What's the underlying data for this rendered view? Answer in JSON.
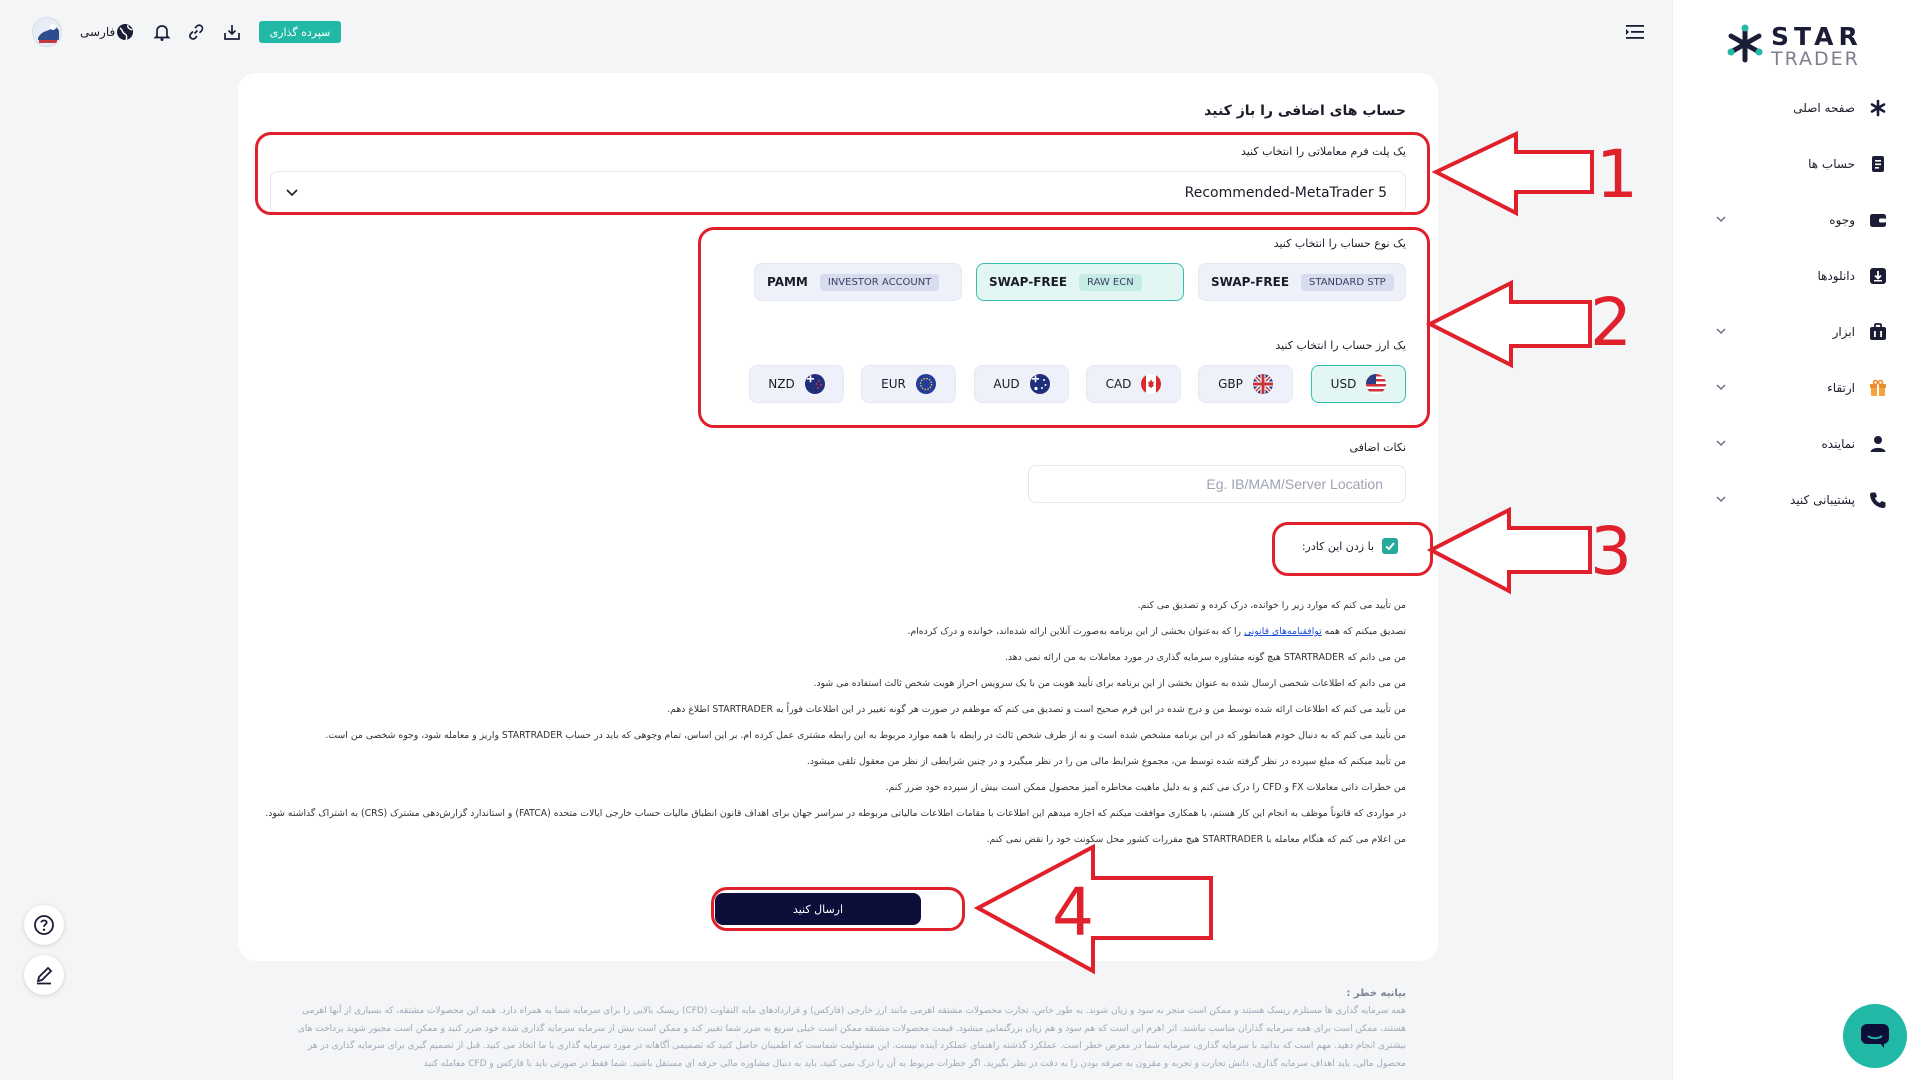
{
  "sidebar": {
    "logo_line1": "STAR",
    "logo_line2": "TRADER",
    "items": [
      {
        "label": "صفحه اصلی",
        "icon": "asterisk-icon"
      },
      {
        "label": "حساب ها",
        "icon": "accounts-icon"
      },
      {
        "label": "وجوه",
        "icon": "wallet-icon"
      },
      {
        "label": "دانلودها",
        "icon": "download-icon"
      },
      {
        "label": "ابزار",
        "icon": "toolbox-icon"
      },
      {
        "label": "ارتقاء",
        "icon": "gift-icon"
      },
      {
        "label": "نماینده",
        "icon": "user-icon"
      },
      {
        "label": "پشتیبانی کنید",
        "icon": "phone-icon"
      }
    ]
  },
  "topbar": {
    "deposit_label": "سپرده گذاری",
    "language_label": "فارسی"
  },
  "form": {
    "title": "حساب های اضافی را باز کنید",
    "platform_label": "یک پلت فرم معاملاتی را انتخاب کنید",
    "platform_value": "Recommended-MetaTrader 5",
    "account_type_label": "یک نوع حساب را انتخاب کنید",
    "account_types": [
      {
        "main": "SWAP-FREE",
        "sub": "STANDARD STP",
        "selected": false
      },
      {
        "main": "SWAP-FREE",
        "sub": "RAW ECN",
        "selected": true
      },
      {
        "main": "PAMM",
        "sub": "INVESTOR ACCOUNT",
        "selected": false
      }
    ],
    "currency_label": "یک ارز حساب را انتخاب کنید",
    "currencies": [
      {
        "code": "USD",
        "selected": true
      },
      {
        "code": "GBP",
        "selected": false
      },
      {
        "code": "CAD",
        "selected": false
      },
      {
        "code": "AUD",
        "selected": false
      },
      {
        "code": "EUR",
        "selected": false
      },
      {
        "code": "NZD",
        "selected": false
      }
    ],
    "notes_label": "نکات اضافی",
    "notes_placeholder": "Eg. IB/MAM/Server Location",
    "agree_label": "با زدن این کادر:",
    "agree_checked": true,
    "terms": [
      {
        "before": "من تأیید می کنم که موارد زیر را خوانده، درک کرده و تصدیق می کنم.",
        "link": "",
        "after": ""
      },
      {
        "before": "تصدیق میکنم که همه ",
        "link": "توافقنامه‌های قانونی",
        "after": " را که به‌عنوان بخشی از این برنامه به‌صورت آنلاین ارائه شده‌اند، خوانده و درک کرده‌ام."
      },
      {
        "before": "من می دانم که STARTRADER هیچ گونه مشاوره سرمایه گذاری در مورد معاملات به من ارائه نمی دهد.",
        "link": "",
        "after": ""
      },
      {
        "before": "من می دانم که اطلاعات شخصی ارسال شده به عنوان بخشی از این برنامه برای تأیید هویت من با یک سرویس احراز هویت شخص ثالث استفاده می شود.",
        "link": "",
        "after": ""
      },
      {
        "before": "من تأیید می کنم که اطلاعات ارائه شده توسط من و درج شده در این فرم صحیح است و تصدیق می کنم که موظفم در صورت هر گونه تغییر در این اطلاعات فوراً به STARTRADER اطلاع دهم.",
        "link": "",
        "after": ""
      },
      {
        "before": "من تأیید می کنم که به دنبال خودم همانطور که در این برنامه مشخص شده است و نه از طرف شخص ثالث در رابطه با همه موارد مربوط به این رابطه مشتری عمل کرده ام. بر این اساس، تمام وجوهی که باید در حساب STARTRADER واریز و معامله شود، وجوه شخصی من است.",
        "link": "",
        "after": ""
      },
      {
        "before": "من تأیید میکنم که مبلغ سپرده در نظر گرفته شده توسط من، مجموع شرایط مالی من را در نظر میگیرد و در چنین شرایطی از نظر من معقول تلقی میشود.",
        "link": "",
        "after": ""
      },
      {
        "before": "من خطرات ذاتی معاملات FX و CFD را درک می کنم و به دلیل ماهیت مخاطره آمیز محصول ممکن است بیش از سپرده خود ضرر کنم.",
        "link": "",
        "after": ""
      },
      {
        "before": "در مواردی که قانوناً موظف به انجام این کار هستم، با همکاری موافقت میکنم که اجازه میدهم این اطلاعات با مقامات اطلاعات مالیاتی مربوطه در سراسر جهان برای اهداف قانون انطباق مالیات حساب خارجی ایالات متحده (FATCA) و استاندارد گزارش‌دهی مشترک (CRS) به اشتراک گذاشته شود.",
        "link": "",
        "after": ""
      },
      {
        "before": "من اعلام می کنم که هنگام معامله با STARTRADER هیچ مقررات کشور محل سکونت خود را نقض نمی کنم.",
        "link": "",
        "after": ""
      }
    ],
    "submit_label": "ارسال کنید"
  },
  "risk": {
    "title": "بیانیه خطر :",
    "text": "همه سرمایه گذاری ها مستلزم ریسک هستند و ممکن است منجر به سود و زیان شوند. به طور خاص، تجارت محصولات مشتقه اهرمی مانند ارز خارجی (فارکس) و قراردادهای مابه التفاوت (CFD) ریسک بالایی را برای سرمایه شما به همراه دارد. همه این محصولات مشتقه، که بسیاری از آنها اهرمی هستند، ممکن است برای همه سرمایه گذاران مناسب نباشند. اثر اهرم این است که هم سود و هم زیان بزرگنمایی میشود. قیمت محصولات مشتقه ممکن است خیلی سریع به ضرر شما تغییر کند و ممکن است بیش از سرمایه سرمایه گذاری شده خود ضرر کنید و ممکن است مجبور شوید پرداخت های بیشتری انجام دهید. مهم است که بدانید با سرمایه گذاری، سرمایه شما در معرض خطر است. عملکرد گذشته راهنمای عملکرد آینده نیست. این مسئولیت شماست که اطمینان حاصل کنید که تصمیمی آگاهانه در مورد سرمایه گذاری با ما اتخاذ می کنید. قبل از تصمیم گیری برای سرمایه گذاری در هر محصول مالی، باید اهداف سرمایه گذاری، دانش تجارت و تجربه و مقرون به صرفه بودن را به دقت در نظر بگیرید. اگر خطرات مربوط به آن را درک نمی کنید، باید به دنبال مشاوره مالی حرفه ای مستقل باشید. شما فقط در صورتی باید با فارکس و CFD معامله کنید"
  },
  "annotations": [
    "1",
    "2",
    "3",
    "4"
  ],
  "colors": {
    "accent": "#22b8a6",
    "submit": "#0d0f3a",
    "annotation": "#e0202a"
  }
}
